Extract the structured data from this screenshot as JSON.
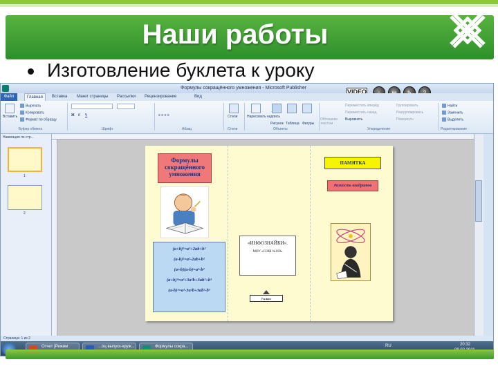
{
  "slide": {
    "title": "Наши работы",
    "bullet": "Изготовление буклета к уроку",
    "colors": {
      "accent": "#3a9b32",
      "light_accent": "#8dc63f"
    }
  },
  "window": {
    "title": "Формулы сокращённого умножения - Microsoft Publisher",
    "video_badge": {
      "main": "VIDEO",
      "sub": "Mac Conta"
    },
    "tabs": [
      "Файл",
      "Главная",
      "Вставка",
      "Макет страницы",
      "Рассылки",
      "Рецензирование",
      "Вид"
    ],
    "active_tab": "Главная",
    "ribbon": {
      "clipboard": {
        "paste": "Вставить",
        "cut": "Вырезать",
        "copy": "Копировать",
        "format": "Формат по образцу",
        "group": "Буфер обмена"
      },
      "font_group": "Шрифт",
      "paragraph_group": "Абзац",
      "styles": {
        "styles": "Стили",
        "group": "Стили"
      },
      "objects": {
        "draw_caption": "Нарисовать надпись",
        "picture": "Рисунок",
        "table": "Таблица",
        "shapes": "Фигуры",
        "group": "Объекты"
      },
      "wrap": "Обтекание текстом",
      "arrange": {
        "forward": "Переместить вперёд",
        "backward": "Переместить назад",
        "align": "Выровнять",
        "group_items": "Группировать",
        "ungroup": "Разгруппировать",
        "rotate": "Повернуть",
        "group": "Упорядочение"
      },
      "editing": {
        "find": "Найти",
        "replace": "Заменить",
        "select": "Выделить",
        "group": "Редактирование"
      }
    },
    "nav_pane": {
      "title": "Навигация по стр...",
      "pages": [
        "1",
        "2"
      ]
    },
    "status": "Страница: 1 из 2",
    "taskbar": {
      "items": [
        {
          "label": "Отчет [Режим сов...",
          "color": "#d04a2a"
        },
        {
          "label": "...оц выпуск-круж...",
          "color": "#2a5bb5"
        },
        {
          "label": "Формулы сокра...",
          "color": "#1a8a7a"
        }
      ],
      "lang": "RU",
      "time": "20:32",
      "date": "09.02.2011"
    }
  },
  "brochure": {
    "title": "Формулы сокращённого умножения",
    "formulas": [
      "(a+b)²=a²+2ab+b²",
      "(a-b)²=a²-2ab+b²",
      "(a+b)(a-b)=a²-b²",
      "(a+b)³=a³+3a²b+3ab²+b³",
      "(a-b)³=a³-3a²b+3ab²-b³"
    ],
    "middle_title": "«ИНФОЗНАЙКИ».",
    "middle_sub": "МОУ «СОШ №100»",
    "class_label": "7 класс",
    "pamyatka": "ПАМЯТКА",
    "raznost": "Разность квадратов"
  }
}
